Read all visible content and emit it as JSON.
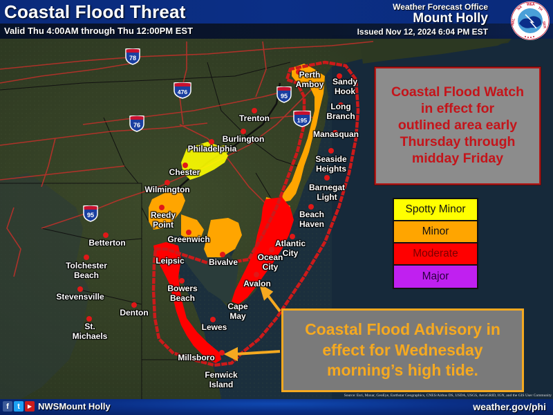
{
  "header": {
    "title": "Coastal Flood Threat",
    "valid": "Valid Thu 4:00AM through Thu 12:00PM EST",
    "office_label": "Weather Forecast Office",
    "office_name": "Mount Holly",
    "issued": "Issued Nov 12, 2024 6:04 PM EST",
    "logo_icon": "nws-logo-icon",
    "logo_text": "NATIONAL WEATHER SERVICE"
  },
  "watch_box": {
    "text": "Coastal Flood Watch\nin effect for\noutlined area early\nThursday through\nmidday Friday",
    "text_color": "#c4141a",
    "border_color": "#b01818"
  },
  "legend": {
    "items": [
      {
        "label": "Spotty Minor",
        "color": "#ffff00"
      },
      {
        "label": "Minor",
        "color": "#ffa500"
      },
      {
        "label": "Moderate",
        "color": "#ff0000"
      },
      {
        "label": "Major",
        "color": "#c020f0"
      }
    ]
  },
  "advisory_box": {
    "text": "Coastal Flood Advisory in\neffect for Wednesday\nmorning’s high tide.",
    "color": "#f5a920"
  },
  "interstates": [
    {
      "number": "78"
    },
    {
      "number": "476"
    },
    {
      "number": "76"
    },
    {
      "number": "95"
    },
    {
      "number": "195"
    },
    {
      "number": "95"
    }
  ],
  "cities": [
    {
      "name": "Perth\nAmboy"
    },
    {
      "name": "Sandy\nHook"
    },
    {
      "name": "Long\nBranch"
    },
    {
      "name": "Manasquan"
    },
    {
      "name": "Seaside\nHeights"
    },
    {
      "name": "Barnegat\nLight"
    },
    {
      "name": "Beach\nHaven"
    },
    {
      "name": "Atlantic\nCity"
    },
    {
      "name": "Ocean\nCity"
    },
    {
      "name": "Avalon"
    },
    {
      "name": "Cape\nMay"
    },
    {
      "name": "Trenton"
    },
    {
      "name": "Burlington"
    },
    {
      "name": "Philadelphia"
    },
    {
      "name": "Chester"
    },
    {
      "name": "Wilmington"
    },
    {
      "name": "Reedy\nPoint"
    },
    {
      "name": "Greenwich"
    },
    {
      "name": "Bivalve"
    },
    {
      "name": "Leipsic"
    },
    {
      "name": "Bowers\nBeach"
    },
    {
      "name": "Lewes"
    },
    {
      "name": "Millsboro"
    },
    {
      "name": "Fenwick\nIsland"
    },
    {
      "name": "Betterton"
    },
    {
      "name": "Tolchester\nBeach"
    },
    {
      "name": "Stevensville"
    },
    {
      "name": "St.\nMichaels"
    },
    {
      "name": "Denton"
    }
  ],
  "source_credit": "Source: Esri, Maxar, GeoEye, Earthstar Geographics, CNES/Airbus DS, USDA, USGS, AeroGRID, IGN, and the GIS User Community",
  "footer": {
    "social": [
      {
        "icon": "facebook-icon",
        "glyph": "f",
        "color": "#3b5998"
      },
      {
        "icon": "twitter-icon",
        "glyph": "t",
        "color": "#1da1f2"
      },
      {
        "icon": "youtube-icon",
        "glyph": "▶",
        "color": "#cc1b1b"
      }
    ],
    "handle": "NWSMount Holly",
    "website": "weather.gov/phi"
  }
}
